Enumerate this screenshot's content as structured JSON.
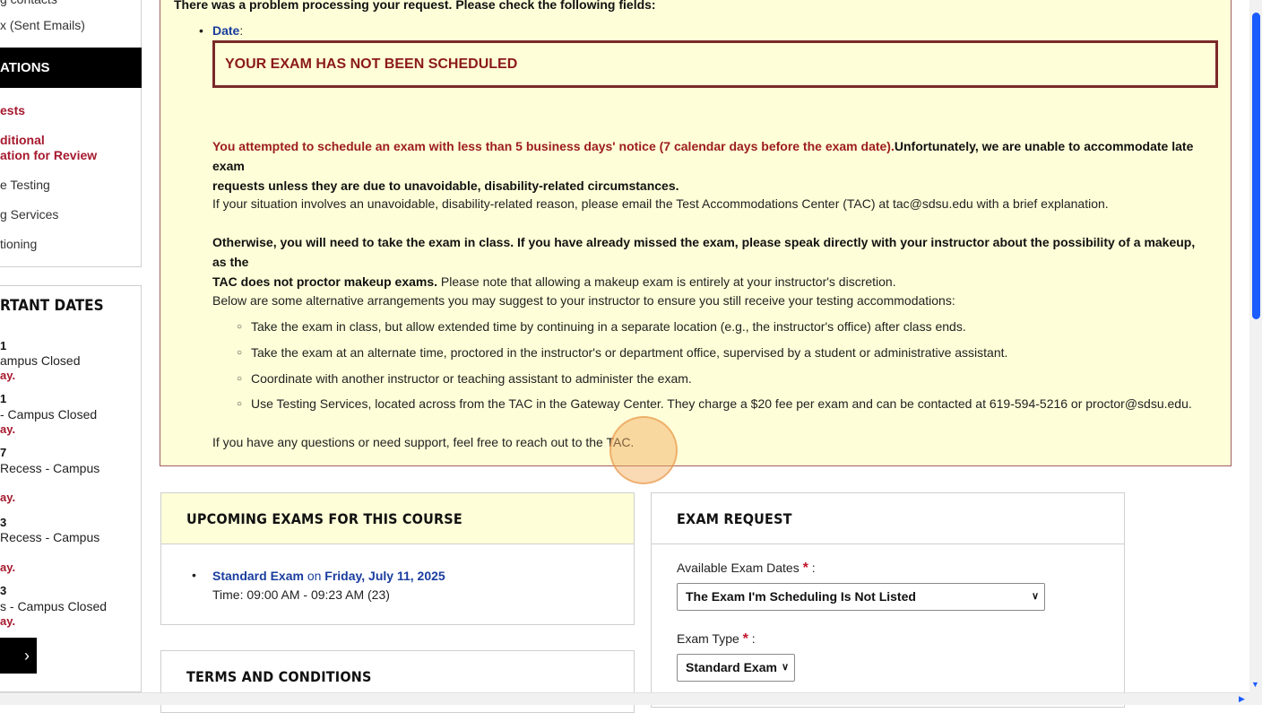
{
  "sidebar": {
    "items": [
      {
        "label": "x (Sent Emails)",
        "style": "dark"
      },
      {
        "label": "ests",
        "style": "red"
      },
      {
        "label": "ditional",
        "style": "red"
      },
      {
        "label": "ation for Review",
        "style": "red"
      },
      {
        "label": "e Testing",
        "style": "dark"
      },
      {
        "label": "g Services",
        "style": "dark"
      },
      {
        "label": "tioning",
        "style": "dark"
      }
    ],
    "section_header": "ATIONS",
    "dates_title": "RTANT DATES",
    "dates": [
      {
        "num": "1",
        "line1": "ampus Closed",
        "line2": "ay."
      },
      {
        "num": "",
        "line1": "- Campus Closed",
        "line2": "ay."
      },
      {
        "num": "7",
        "line1": "Recess - Campus",
        "line2": "ay."
      },
      {
        "num": "3",
        "line1": "Recess - Campus",
        "line2": "ay."
      },
      {
        "num": "3",
        "line1": "s - Campus Closed",
        "line2": "ay."
      }
    ],
    "next_label": "›"
  },
  "alert": {
    "intro": "There was a problem processing your request. Please check the following fields:",
    "field_label": "Date",
    "not_scheduled": "YOUR EXAM HAS NOT BEEN SCHEDULED",
    "p1_red": "You attempted to schedule an exam with less than 5 business days' notice (7 calendar days before the exam date).",
    "p1_bold_a": "Unfortunately, we are unable to accommodate late exam",
    "p1_bold_b": "requests unless they are due to unavoidable, disability-related circumstances.",
    "p2": "If your situation involves an unavoidable, disability-related reason, please email the Test Accommodations Center (TAC) at tac@sdsu.edu with a brief explanation.",
    "p3_bold_a": "Otherwise, you will need to take the exam in class. If you have already missed the exam, please speak directly with your instructor about the possibility of a makeup, as the",
    "p3_bold_b": "TAC does not proctor makeup exams.",
    "p3_normal": " Please note that allowing a makeup exam is entirely at your instructor's discretion.",
    "p4": "Below are some alternative arrangements you may suggest to your instructor to ensure you still receive your testing accommodations:",
    "list": [
      "Take the exam in class, but allow extended time by continuing in a separate location (e.g., the instructor's office) after class ends.",
      "Take the exam at an alternate time, proctored in the instructor's or department office, supervised by a student or administrative assistant.",
      "Coordinate with another instructor or teaching assistant to administer the exam.",
      "Use Testing Services, located across from the TAC in the Gateway Center. They charge a $20 fee per exam and can be contacted at 619-594-5216 or proctor@sdsu.edu."
    ],
    "closing": "If you have any questions or need support, feel free to reach out to the TAC."
  },
  "upcoming": {
    "title": "UPCOMING EXAMS FOR THIS COURSE",
    "exam_name": "Standard Exam",
    "on_word": " on ",
    "exam_date": "Friday, July 11, 2025",
    "time": "Time: 09:00 AM - 09:23 AM (23)"
  },
  "terms": {
    "title": "TERMS AND CONDITIONS"
  },
  "request": {
    "title": "EXAM REQUEST",
    "dates_label": "Available Exam Dates",
    "dates_value": "The Exam I'm Scheduling Is Not Listed",
    "type_label": "Exam Type",
    "type_value": "Standard Exam",
    "required_mark": "*",
    "colon": " :"
  },
  "colors": {
    "alert_bg": "#fefed8",
    "alert_red": "#9c1c1c",
    "link_blue": "#1a3d9e",
    "scroll_blue": "#1a5cff"
  }
}
